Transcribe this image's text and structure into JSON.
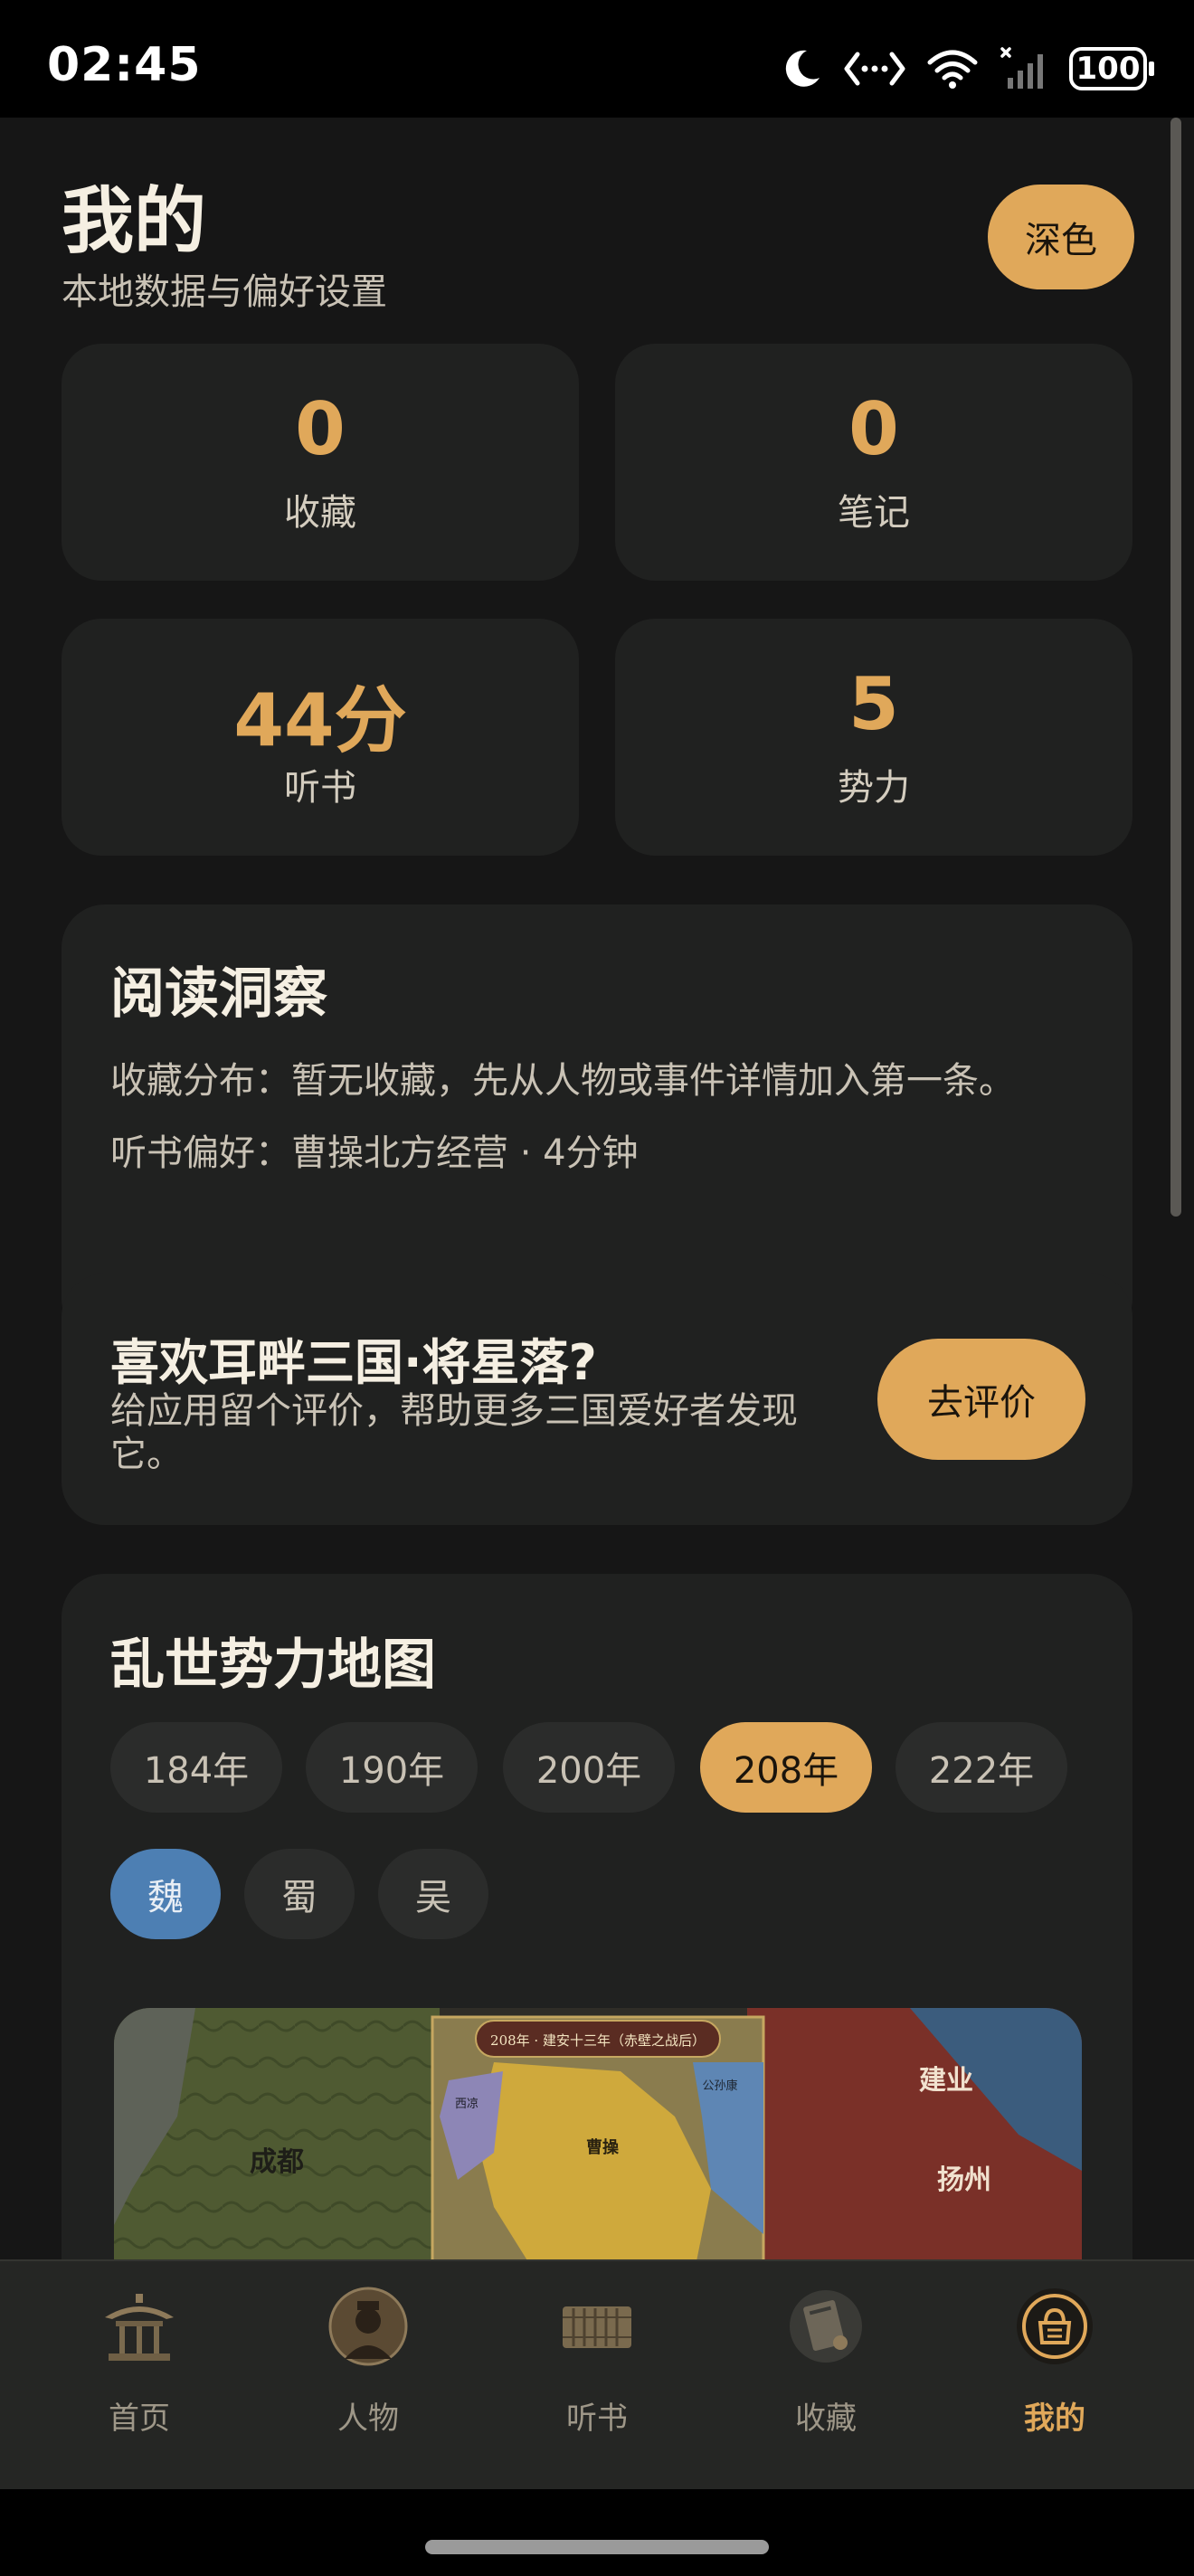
{
  "status": {
    "time": "02:45",
    "battery": "100",
    "icons": [
      "moon-icon",
      "code-icon",
      "wifi-icon",
      "cell-signal-icon",
      "battery-icon"
    ]
  },
  "header": {
    "title": "我的",
    "subtitle": "本地数据与偏好设置",
    "theme_button": "深色"
  },
  "stats": [
    {
      "value": "0",
      "label": "收藏"
    },
    {
      "value": "0",
      "label": "笔记"
    },
    {
      "value": "44分",
      "label": "听书"
    },
    {
      "value": "5",
      "label": "势力"
    }
  ],
  "insight": {
    "title": "阅读洞察",
    "favorites_line": "收藏分布：暂无收藏，先从人物或事件详情加入第一条。",
    "listening_line": "听书偏好：曹操北方经营 · 4分钟"
  },
  "rate": {
    "title": "喜欢耳畔三国·将星落?",
    "text": "给应用留个评价，帮助更多三国爱好者发现它。",
    "button": "去评价"
  },
  "map": {
    "title": "乱世势力地图",
    "years": [
      "184年",
      "190年",
      "200年",
      "208年",
      "222年"
    ],
    "selected_year": "208年",
    "factions": [
      "魏",
      "蜀",
      "吴"
    ],
    "selected_faction": "魏",
    "image_caption": "208年 · 建安十三年（赤壁之战后）",
    "image_labels": [
      "成都",
      "建业",
      "扬州",
      "曹操",
      "公孙康",
      "西凉"
    ]
  },
  "nav": {
    "items": [
      {
        "label": "首页",
        "icon": "pavilion-icon"
      },
      {
        "label": "人物",
        "icon": "portrait-icon"
      },
      {
        "label": "听书",
        "icon": "bamboo-scroll-icon"
      },
      {
        "label": "收藏",
        "icon": "book-icon"
      },
      {
        "label": "我的",
        "icon": "profile-icon"
      }
    ],
    "active": "我的"
  },
  "colors": {
    "accent": "#e0a85a",
    "faction_wei": "#4d7fb3",
    "card_bg": "#202120",
    "page_bg": "#161616"
  }
}
